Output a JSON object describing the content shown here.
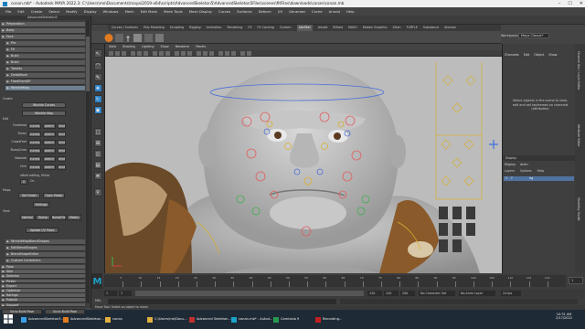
{
  "titlebar": {
    "text": "conan.mb* - Autodesk MAYA 2022.3: C:\\Users\\me\\Documents\\maya\\2019-x64\\scripts\\AdvancedSkeleton5\\AdvancedSkeleton5Files\\scenes\\fitFiles\\downloads\\conan\\conan.mb"
  },
  "menubar": [
    "File",
    "Edit",
    "Create",
    "Select",
    "Modify",
    "Display",
    "Windows",
    "Mesh",
    "Edit Mesh",
    "Mesh Tools",
    "Mesh Display",
    "Curves",
    "Surfaces",
    "Deform",
    "UV",
    "Generate",
    "Cache",
    "Arnold",
    "Help"
  ],
  "statusline": {
    "mode": "Modeling",
    "live": "No Live Surface",
    "workspace_label": "Workspace:",
    "workspace": "Maya Classic*",
    "signin": "Sign In"
  },
  "shelf_tabs": [
    "Curves / Surfaces",
    "Poly Modeling",
    "Sculpting",
    "Rigging",
    "Animation",
    "Rendering",
    "FX",
    "FX Caching",
    "Custom",
    "AdvSkel",
    "Arnold",
    "Bifrost",
    "MASH",
    "Motion Graphics",
    "XGen",
    "TURTLE",
    "Substance",
    "Aivision"
  ],
  "shelf_active": "AdvSkel",
  "left_panel": {
    "title": "AdvancedSkeleton5",
    "rows": [
      {
        "label": "Preparation",
        "indent": false,
        "hl": false
      },
      {
        "label": "Body",
        "indent": false,
        "hl": false
      },
      {
        "label": "Face",
        "indent": false,
        "hl": false
      },
      {
        "label": "Pre",
        "indent": true,
        "hl": false
      },
      {
        "label": "Fit",
        "indent": true,
        "hl": false
      },
      {
        "label": "Build",
        "indent": true,
        "hl": false
      },
      {
        "label": "Build",
        "indent": true,
        "hl": false
      },
      {
        "label": "Tweaks",
        "indent": true,
        "hl": false
      },
      {
        "label": "DeltaMush",
        "indent": true,
        "hl": false
      },
      {
        "label": "FixesFromDP",
        "indent": true,
        "hl": false
      },
      {
        "label": "WrinkleMap",
        "indent": true,
        "hl": true
      }
    ],
    "create_label": "Create",
    "wrinkle_curves": "Wrinkle Curves",
    "wrinkle_map": "Wrinkle Map",
    "edit_label": "Edit",
    "edit_rows": [
      "Forehead",
      "Frown",
      "CrowsFeet",
      "BumpCrow",
      "Nasolab",
      "Chin"
    ],
    "edit_buttons": [
      "curves",
      "sketch",
      "bind"
    ],
    "offset_label": "offset editing, Mirror",
    "offset_value": "0",
    "on_label": "On",
    "maps_label": "Maps",
    "set_folder": "Set Folder",
    "open_folder": "Open Folder",
    "settings": "Settings",
    "view_label": "View",
    "view_buttons": [
      "Normal",
      "Bump",
      "BumpFile",
      "Masks"
    ],
    "update_uv": "Update UV Place",
    "lower_rows": [
      "WrinkleMapBlendShapes",
      "EditBlendShapes",
      "BlendShapeEditor",
      "Custom Controllers"
    ],
    "bottom_rows": [
      "Pose",
      "Skin",
      "Selector",
      "Picker",
      "Export",
      "Optimize",
      "Ratings",
      "Publish",
      "Support"
    ],
    "bottom_links": [
      "Go to Build Pose",
      "Go to Build Pose"
    ]
  },
  "viewport_menu": [
    "View",
    "Shading",
    "Lighting",
    "Show",
    "Renderer",
    "Panels"
  ],
  "channel_box": {
    "tabs": [
      "Channels",
      "Edit",
      "Object",
      "Show"
    ],
    "message": "Select objects in the scene to view, edit and set keyframes on channels (attributes)",
    "layer_title": "Display",
    "layer_tabs": [
      "Display",
      "Anim"
    ],
    "layer_menu": [
      "Layers",
      "Options",
      "Help"
    ],
    "layer_name": "rig",
    "layer_flags": [
      "V",
      "P"
    ]
  },
  "right_strip": [
    "Channel Box / Layer Editor",
    "Attribute Editor",
    "Modeling Toolkit"
  ],
  "timeline": {
    "ticks": [
      "5",
      "10",
      "15",
      "20",
      "25",
      "30",
      "35",
      "40",
      "45",
      "50",
      "55",
      "60",
      "65",
      "70",
      "75",
      "80",
      "85",
      "90",
      "95",
      "100",
      "105",
      "110",
      "115",
      "120"
    ],
    "current_frame": "1"
  },
  "range": {
    "start": "1",
    "inner_start": "1",
    "inner_end": "120",
    "end": "120",
    "end2": "200",
    "fps": "24 fps",
    "char_set": "No Character Set",
    "anim_layer": "No Anim Layer"
  },
  "mel": {
    "label": "MEL"
  },
  "help_text": "Move Tool: Select an object to move.",
  "taskbar": {
    "items": [
      {
        "label": "AdvancedSkeleton5...",
        "color": "#3aa0e8"
      },
      {
        "label": "AdvancedSkeleton...",
        "color": "#e07b20"
      },
      {
        "label": "conan",
        "color": "#e0b040"
      },
      {
        "label": "C:\\Users\\me\\Docu...",
        "color": "#e0b040"
      },
      {
        "label": "Advanced Skeleton...",
        "color": "#c03030"
      },
      {
        "label": "conan.mb* - Autod...",
        "color": "#1aa3c8"
      },
      {
        "label": "Camtasia 9",
        "color": "#2a9a50"
      },
      {
        "label": "Recording...",
        "color": "#c02020"
      }
    ],
    "time": "10:31 AM",
    "date": "2/17/2022"
  },
  "colors": {
    "accent": "#2e82c6",
    "highlight": "#6d7f90",
    "viewport_bg": "#bcbcbc"
  }
}
